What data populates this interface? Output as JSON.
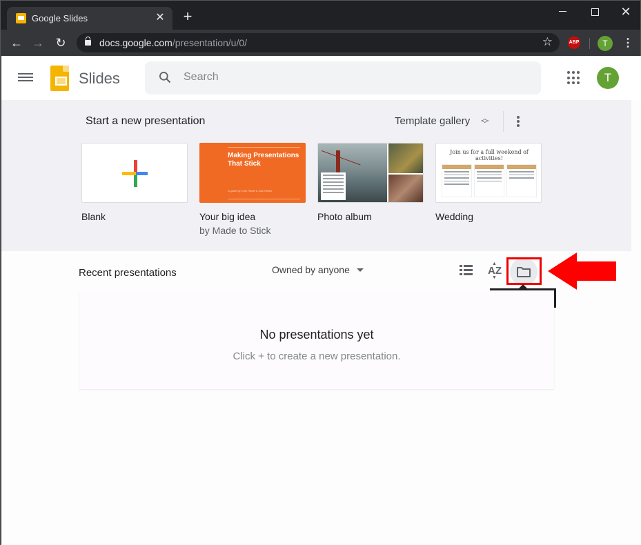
{
  "browser": {
    "tab_title": "Google Slides",
    "new_tab_label": "+",
    "url_host": "docs.google.com",
    "url_path": "/presentation/u/0/",
    "extension_abp": "ABP",
    "profile_initial": "T"
  },
  "app": {
    "name": "Slides",
    "search_placeholder": "Search",
    "account_initial": "T"
  },
  "templates": {
    "heading": "Start a new presentation",
    "gallery_label": "Template gallery",
    "items": [
      {
        "label": "Blank",
        "sub": ""
      },
      {
        "label": "Your big idea",
        "sub": "by Made to Stick",
        "thumb_title": "Making Presentations That Stick",
        "thumb_author": "A guide by Chip Heath & Dan Heath"
      },
      {
        "label": "Photo album",
        "sub": ""
      },
      {
        "label": "Wedding",
        "sub": "",
        "thumb_title": "Join us for a full weekend of activities!"
      }
    ]
  },
  "recent": {
    "title": "Recent presentations",
    "owner_filter": "Owned by anyone",
    "sort_label": "AZ",
    "tooltip": "Open file picker",
    "empty_title": "No presentations yet",
    "empty_sub": "Click + to create a new presentation."
  },
  "colors": {
    "accent_red": "#ff0000",
    "slides_yellow": "#f4b400",
    "avatar_green": "#65a235"
  }
}
